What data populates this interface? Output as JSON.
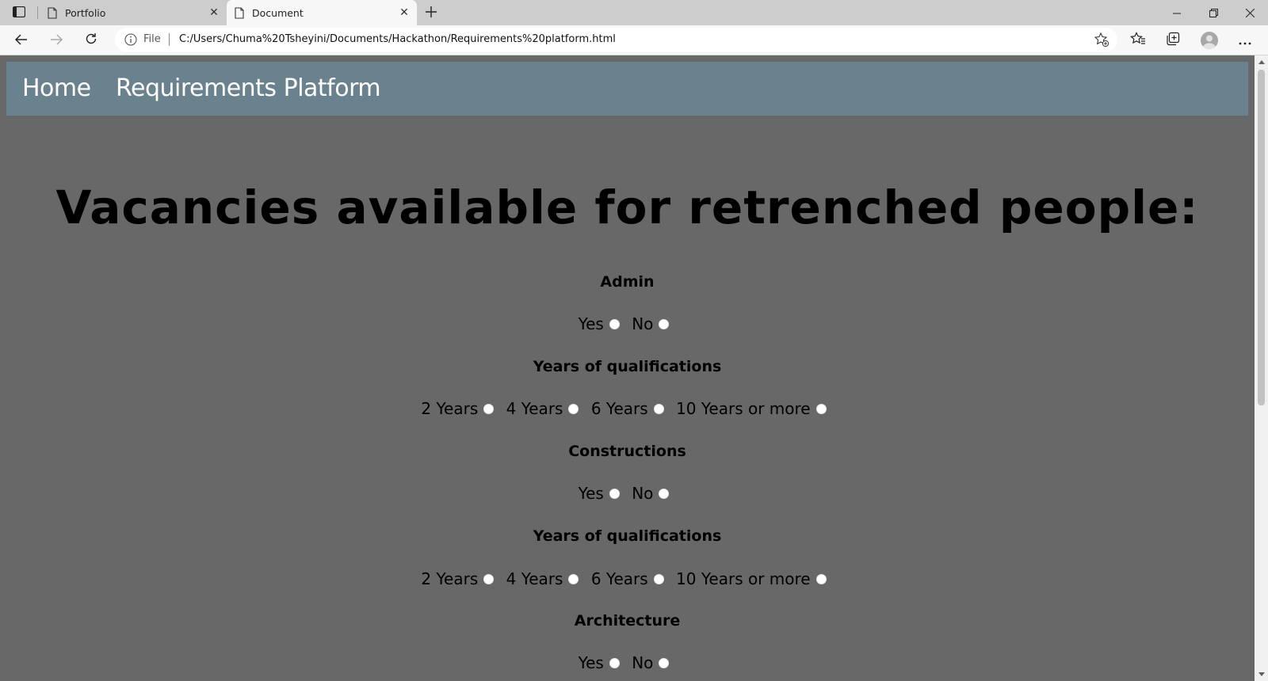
{
  "browser": {
    "tabs": [
      {
        "title": "Portfolio",
        "active": false
      },
      {
        "title": "Document",
        "active": true
      }
    ],
    "address": {
      "scheme_label": "File",
      "url": "C:/Users/Chuma%20Tsheyini/Documents/Hackathon/Requirements%20platform.html"
    },
    "icons": {
      "tab_actions": "tab-actions-icon",
      "back": "back-arrow-icon",
      "forward": "forward-arrow-icon",
      "refresh": "refresh-icon",
      "info": "info-icon",
      "add_favorite": "star-plus-icon",
      "favorites": "favorites-icon",
      "collections": "collections-icon",
      "profile": "profile-avatar-icon",
      "more": "more-dots-icon"
    }
  },
  "page": {
    "nav": {
      "home": "Home",
      "requirements": "Requirements Platform"
    },
    "title": "Vacancies available for retrenched people:",
    "sections": [
      {
        "heading": "Admin",
        "options": [
          "Yes",
          "No"
        ]
      },
      {
        "heading": "Years of qualifications",
        "options": [
          "2 Years",
          "4 Years",
          "6 Years",
          "10 Years or more"
        ]
      },
      {
        "heading": "Constructions",
        "options": [
          "Yes",
          "No"
        ]
      },
      {
        "heading": "Years of qualifications",
        "options": [
          "2 Years",
          "4 Years",
          "6 Years",
          "10 Years or more"
        ]
      },
      {
        "heading": "Architecture",
        "options": [
          "Yes",
          "No"
        ]
      }
    ]
  },
  "colors": {
    "page_background": "#686868",
    "navbar_background": "#6a818e",
    "nav_text": "#ffffff"
  }
}
